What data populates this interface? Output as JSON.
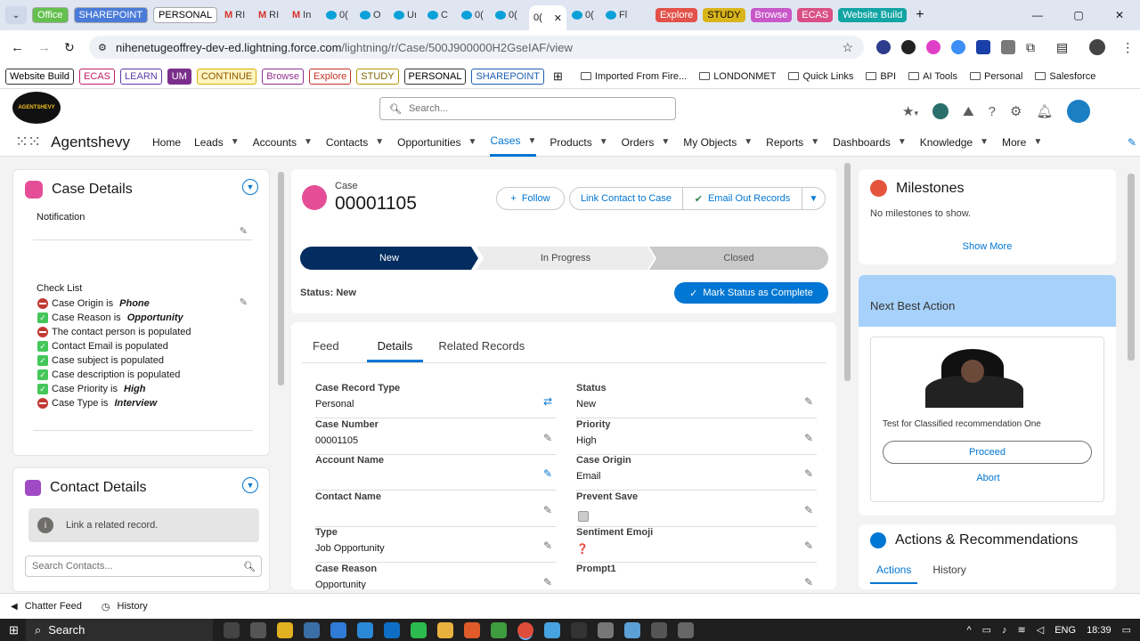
{
  "browser": {
    "tab_chips": [
      {
        "label": "Office",
        "bg": "#63c04d",
        "fg": "#fff"
      },
      {
        "label": "SHAREPOINT",
        "bg": "#4a7bd8",
        "fg": "#fff"
      },
      {
        "label": "PERSONAL",
        "bg": "#fff",
        "fg": "#000"
      }
    ],
    "mini_tabs": [
      "RI",
      "RI",
      "In",
      "0(",
      "O",
      "Uı",
      "C",
      "0(",
      "0("
    ],
    "active_tab": "0(",
    "after_tabs": [
      "0(",
      "Fl"
    ],
    "right_chips": [
      {
        "label": "Explore",
        "bg": "#e2524a",
        "fg": "#fff"
      },
      {
        "label": "STUDY",
        "bg": "#d9b51c",
        "fg": "#000"
      },
      {
        "label": "Browse",
        "bg": "#c857c8",
        "fg": "#fff"
      },
      {
        "label": "ECAS",
        "bg": "#d94f86",
        "fg": "#fff"
      },
      {
        "label": "Website Build",
        "bg": "#13a4a4",
        "fg": "#fff"
      }
    ],
    "url_host": "nihenetugeoffrey-dev-ed.lightning.force.com",
    "url_path": "/lightning/r/Case/500J900000H2GseIAF/view",
    "bookmarks_chips": [
      {
        "label": "Website Build",
        "bg": "#fff",
        "fg": "#000",
        "border": "#333"
      },
      {
        "label": "ECAS",
        "bg": "#fff",
        "fg": "#c21e66",
        "border": "#c21e66"
      },
      {
        "label": "LEARN",
        "bg": "#fff",
        "fg": "#5b3aa8",
        "border": "#5b3aa8"
      },
      {
        "label": "UM",
        "bg": "#7b2f8c",
        "fg": "#fff",
        "border": "#7b2f8c"
      },
      {
        "label": "CONTINUE",
        "bg": "#fff3c0",
        "fg": "#8a5a00",
        "border": "#d8b100"
      },
      {
        "label": "Browse",
        "bg": "#fff",
        "fg": "#8f2f8f",
        "border": "#8f2f8f"
      },
      {
        "label": "Explore",
        "bg": "#fff",
        "fg": "#c43024",
        "border": "#c43024"
      },
      {
        "label": "STUDY",
        "bg": "#fff",
        "fg": "#806400",
        "border": "#b89600"
      },
      {
        "label": "PERSONAL",
        "bg": "#fff",
        "fg": "#000",
        "border": "#333"
      },
      {
        "label": "SHAREPOINT",
        "bg": "#fff",
        "fg": "#1b5fb2",
        "border": "#1b5fb2"
      }
    ],
    "bookmark_folders": [
      "Imported From Fire...",
      "LONDONMET",
      "Quick Links",
      "BPI",
      "AI Tools",
      "Personal",
      "Salesforce"
    ]
  },
  "sf": {
    "logo_text": "AGENTSHEVY",
    "search_placeholder": "Search...",
    "app_name": "Agentshevy",
    "nav": [
      "Home",
      "Leads",
      "Accounts",
      "Contacts",
      "Opportunities",
      "Cases",
      "Products",
      "Orders",
      "My Objects",
      "Reports",
      "Dashboards",
      "Knowledge",
      "More"
    ],
    "active_nav": "Cases"
  },
  "case_details": {
    "title": "Case Details",
    "notification_label": "Notification",
    "checklist_label": "Check List",
    "checklist": [
      {
        "status": "no",
        "text": "Case Origin is ",
        "em": "Phone"
      },
      {
        "status": "ok",
        "text": "Case Reason is ",
        "em": "Opportunity"
      },
      {
        "status": "no",
        "text": "The contact person is populated",
        "em": ""
      },
      {
        "status": "ok",
        "text": "Contact Email is populated",
        "em": ""
      },
      {
        "status": "ok",
        "text": "Case subject is populated",
        "em": ""
      },
      {
        "status": "ok",
        "text": "Case description is populated",
        "em": ""
      },
      {
        "status": "ok",
        "text": "Case Priority is ",
        "em": "High"
      },
      {
        "status": "no",
        "text": "Case Type is ",
        "em": "Interview"
      }
    ]
  },
  "contact_details": {
    "title": "Contact Details",
    "info": "Link a related record.",
    "search_placeholder": "Search Contacts..."
  },
  "record": {
    "object_label": "Case",
    "number": "00001105",
    "follow": "Follow",
    "link_contact": "Link Contact to Case",
    "email_out": "Email Out Records",
    "path": [
      "New",
      "In Progress",
      "Closed"
    ],
    "status_text": "Status: New",
    "mark_complete": "Mark Status as Complete",
    "tabs": [
      "Feed",
      "Details",
      "Related Records"
    ],
    "active_tab": "Details",
    "left_fields": [
      {
        "label": "Case Record Type",
        "value": "Personal"
      },
      {
        "label": "Case Number",
        "value": "00001105"
      },
      {
        "label": "Account Name",
        "value": ""
      },
      {
        "label": "Contact Name",
        "value": ""
      },
      {
        "label": "Type",
        "value": "Job Opportunity"
      },
      {
        "label": "Case Reason",
        "value": "Opportunity"
      }
    ],
    "right_fields": [
      {
        "label": "Status",
        "value": "New"
      },
      {
        "label": "Priority",
        "value": "High"
      },
      {
        "label": "Case Origin",
        "value": "Email"
      },
      {
        "label": "Prevent Save",
        "value": ""
      },
      {
        "label": "Sentiment Emoji",
        "value": "❓"
      },
      {
        "label": "Prompt1",
        "value": ""
      }
    ]
  },
  "milestones": {
    "title": "Milestones",
    "empty": "No milestones to show.",
    "show_more": "Show More"
  },
  "nba": {
    "title": "Next Best Action",
    "desc": "Test for Classified recommendation One",
    "proceed": "Proceed",
    "abort": "Abort"
  },
  "actions": {
    "title": "Actions & Recommendations",
    "tabs": [
      "Actions",
      "History"
    ]
  },
  "utility": {
    "chatter": "Chatter Feed",
    "history": "History"
  },
  "taskbar": {
    "search": "Search",
    "lang": "ENG",
    "time": "18:39"
  }
}
